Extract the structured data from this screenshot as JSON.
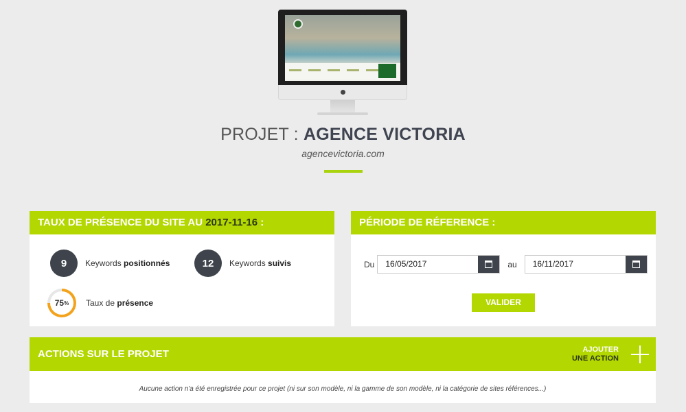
{
  "project": {
    "prefix": "PROJET : ",
    "name": "AGENCE VICTORIA",
    "url": "agencevictoria.com"
  },
  "presence_panel": {
    "title_prefix": "TAUX DE PRÉSENCE DU SITE AU ",
    "date": "2017-11-16",
    "title_suffix": " :",
    "keywords_positioned": {
      "count": "9",
      "label_pre": "Keywords ",
      "label_bold": "positionnés"
    },
    "keywords_followed": {
      "count": "12",
      "label_pre": "Keywords ",
      "label_bold": "suivis"
    },
    "presence_rate": {
      "value": "75",
      "unit": "%",
      "fraction": 0.75,
      "label_pre": "Taux de ",
      "label_bold": "présence"
    }
  },
  "period_panel": {
    "title": "PÉRIODE DE RÉFERENCE :",
    "from_label": "Du",
    "from_value": "16/05/2017",
    "to_label": "au",
    "to_value": "16/11/2017",
    "submit_label": "VALIDER",
    "calendar_icon": "calendar-icon"
  },
  "actions_panel": {
    "title": "ACTIONS SUR LE PROJET",
    "add_line1": "AJOUTER",
    "add_line2": "UNE ACTION",
    "add_icon": "plus-icon",
    "empty_message": "Aucune action n'a été enregistrée pour ce projet (ni sur son modèle, ni la gamme de son modèle, ni la catégorie de sites références...)"
  },
  "colors": {
    "accent": "#b3d700",
    "dark": "#3e434c",
    "ring": "#f3a31b"
  }
}
